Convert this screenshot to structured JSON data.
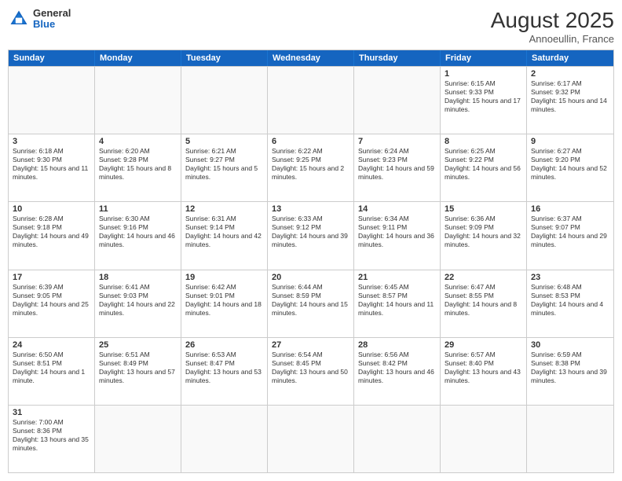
{
  "header": {
    "logo": {
      "general": "General",
      "blue": "Blue"
    },
    "title": "August 2025",
    "location": "Annoeullin, France"
  },
  "days_of_week": [
    "Sunday",
    "Monday",
    "Tuesday",
    "Wednesday",
    "Thursday",
    "Friday",
    "Saturday"
  ],
  "rows": [
    [
      {
        "day": "",
        "empty": true
      },
      {
        "day": "",
        "empty": true
      },
      {
        "day": "",
        "empty": true
      },
      {
        "day": "",
        "empty": true
      },
      {
        "day": "",
        "empty": true
      },
      {
        "day": "1",
        "text": "Sunrise: 6:15 AM\nSunset: 9:33 PM\nDaylight: 15 hours and 17 minutes."
      },
      {
        "day": "2",
        "text": "Sunrise: 6:17 AM\nSunset: 9:32 PM\nDaylight: 15 hours and 14 minutes."
      }
    ],
    [
      {
        "day": "3",
        "text": "Sunrise: 6:18 AM\nSunset: 9:30 PM\nDaylight: 15 hours and 11 minutes."
      },
      {
        "day": "4",
        "text": "Sunrise: 6:20 AM\nSunset: 9:28 PM\nDaylight: 15 hours and 8 minutes."
      },
      {
        "day": "5",
        "text": "Sunrise: 6:21 AM\nSunset: 9:27 PM\nDaylight: 15 hours and 5 minutes."
      },
      {
        "day": "6",
        "text": "Sunrise: 6:22 AM\nSunset: 9:25 PM\nDaylight: 15 hours and 2 minutes."
      },
      {
        "day": "7",
        "text": "Sunrise: 6:24 AM\nSunset: 9:23 PM\nDaylight: 14 hours and 59 minutes."
      },
      {
        "day": "8",
        "text": "Sunrise: 6:25 AM\nSunset: 9:22 PM\nDaylight: 14 hours and 56 minutes."
      },
      {
        "day": "9",
        "text": "Sunrise: 6:27 AM\nSunset: 9:20 PM\nDaylight: 14 hours and 52 minutes."
      }
    ],
    [
      {
        "day": "10",
        "text": "Sunrise: 6:28 AM\nSunset: 9:18 PM\nDaylight: 14 hours and 49 minutes."
      },
      {
        "day": "11",
        "text": "Sunrise: 6:30 AM\nSunset: 9:16 PM\nDaylight: 14 hours and 46 minutes."
      },
      {
        "day": "12",
        "text": "Sunrise: 6:31 AM\nSunset: 9:14 PM\nDaylight: 14 hours and 42 minutes."
      },
      {
        "day": "13",
        "text": "Sunrise: 6:33 AM\nSunset: 9:12 PM\nDaylight: 14 hours and 39 minutes."
      },
      {
        "day": "14",
        "text": "Sunrise: 6:34 AM\nSunset: 9:11 PM\nDaylight: 14 hours and 36 minutes."
      },
      {
        "day": "15",
        "text": "Sunrise: 6:36 AM\nSunset: 9:09 PM\nDaylight: 14 hours and 32 minutes."
      },
      {
        "day": "16",
        "text": "Sunrise: 6:37 AM\nSunset: 9:07 PM\nDaylight: 14 hours and 29 minutes."
      }
    ],
    [
      {
        "day": "17",
        "text": "Sunrise: 6:39 AM\nSunset: 9:05 PM\nDaylight: 14 hours and 25 minutes."
      },
      {
        "day": "18",
        "text": "Sunrise: 6:41 AM\nSunset: 9:03 PM\nDaylight: 14 hours and 22 minutes."
      },
      {
        "day": "19",
        "text": "Sunrise: 6:42 AM\nSunset: 9:01 PM\nDaylight: 14 hours and 18 minutes."
      },
      {
        "day": "20",
        "text": "Sunrise: 6:44 AM\nSunset: 8:59 PM\nDaylight: 14 hours and 15 minutes."
      },
      {
        "day": "21",
        "text": "Sunrise: 6:45 AM\nSunset: 8:57 PM\nDaylight: 14 hours and 11 minutes."
      },
      {
        "day": "22",
        "text": "Sunrise: 6:47 AM\nSunset: 8:55 PM\nDaylight: 14 hours and 8 minutes."
      },
      {
        "day": "23",
        "text": "Sunrise: 6:48 AM\nSunset: 8:53 PM\nDaylight: 14 hours and 4 minutes."
      }
    ],
    [
      {
        "day": "24",
        "text": "Sunrise: 6:50 AM\nSunset: 8:51 PM\nDaylight: 14 hours and 1 minute."
      },
      {
        "day": "25",
        "text": "Sunrise: 6:51 AM\nSunset: 8:49 PM\nDaylight: 13 hours and 57 minutes."
      },
      {
        "day": "26",
        "text": "Sunrise: 6:53 AM\nSunset: 8:47 PM\nDaylight: 13 hours and 53 minutes."
      },
      {
        "day": "27",
        "text": "Sunrise: 6:54 AM\nSunset: 8:45 PM\nDaylight: 13 hours and 50 minutes."
      },
      {
        "day": "28",
        "text": "Sunrise: 6:56 AM\nSunset: 8:42 PM\nDaylight: 13 hours and 46 minutes."
      },
      {
        "day": "29",
        "text": "Sunrise: 6:57 AM\nSunset: 8:40 PM\nDaylight: 13 hours and 43 minutes."
      },
      {
        "day": "30",
        "text": "Sunrise: 6:59 AM\nSunset: 8:38 PM\nDaylight: 13 hours and 39 minutes."
      }
    ],
    [
      {
        "day": "31",
        "text": "Sunrise: 7:00 AM\nSunset: 8:36 PM\nDaylight: 13 hours and 35 minutes."
      },
      {
        "day": "",
        "empty": true
      },
      {
        "day": "",
        "empty": true
      },
      {
        "day": "",
        "empty": true
      },
      {
        "day": "",
        "empty": true
      },
      {
        "day": "",
        "empty": true
      },
      {
        "day": "",
        "empty": true
      }
    ]
  ]
}
